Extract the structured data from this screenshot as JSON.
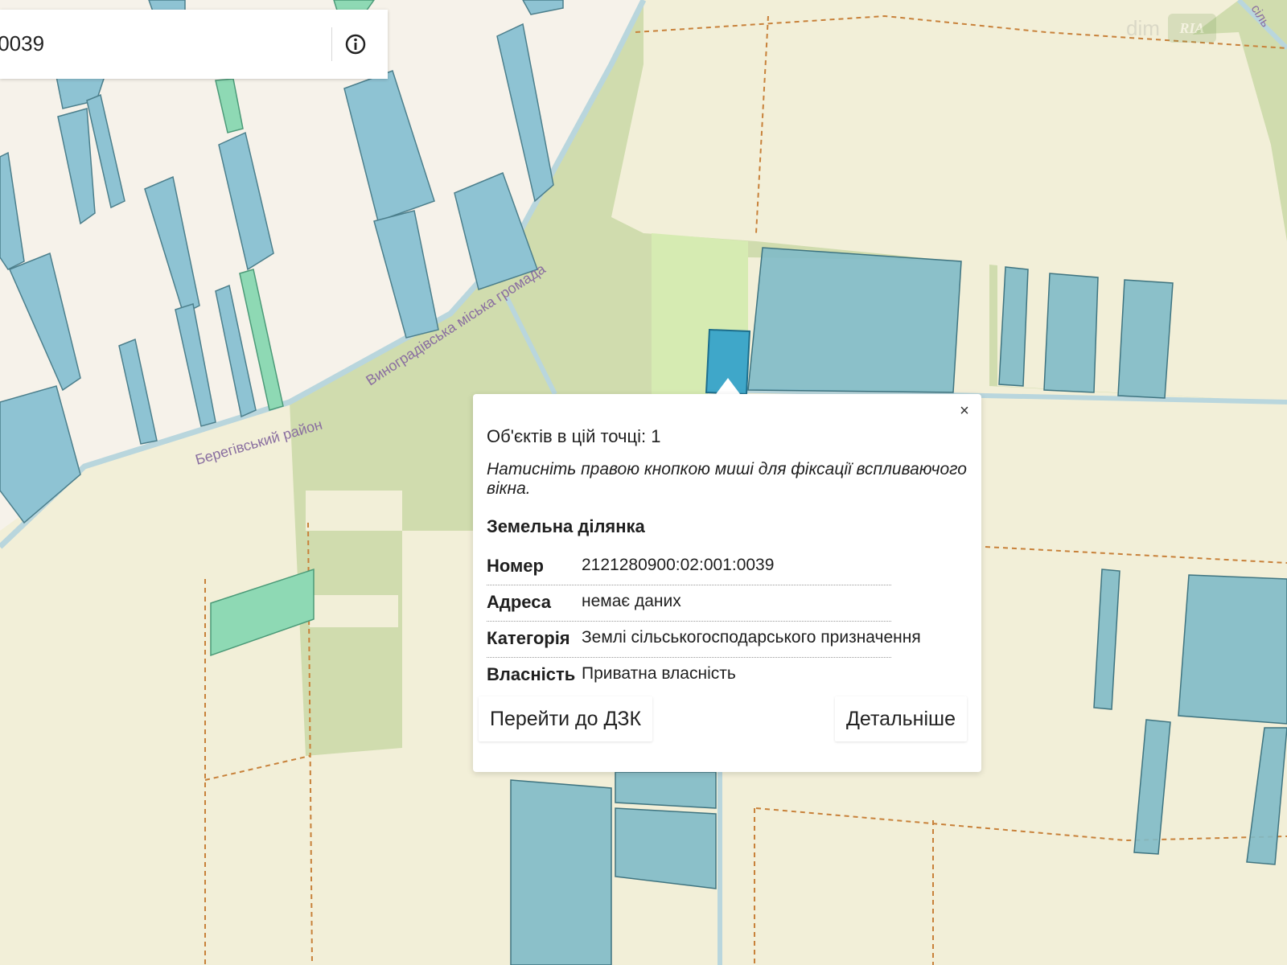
{
  "search": {
    "value": ":0039"
  },
  "map": {
    "labels": {
      "hromada": "Виноградівська міська громада",
      "raion": "Берегівський район",
      "corner": "сіль"
    },
    "colors": {
      "background_fields": "#f2efd8",
      "urban_area": "#f6f2ea",
      "forest": "#cfdcae",
      "meadow": "#d6ebb2",
      "parcel": "#8ec3d3",
      "parcel_border": "#4c7f8c",
      "parcel_green": "#8ed9b4",
      "selected_parcel": "#3fa7c9",
      "admin_border": "#c8813a",
      "road": "#b9d6dd"
    }
  },
  "watermark": {
    "left": "dim",
    "right": "RIA"
  },
  "popup": {
    "close": "×",
    "objects_count": "Об'єктів в цій точці: 1",
    "hint": "Натисніть правою кнопкою миші для фіксації вспливаючого вікна.",
    "section_title": "Земельна ділянка",
    "rows": [
      {
        "key": "Номер",
        "value": "2121280900:02:001:0039"
      },
      {
        "key": "Адреса",
        "value": "немає даних"
      },
      {
        "key": "Категорія",
        "value": "Землі сільськогосподарського призначення"
      },
      {
        "key": "Власність",
        "value": "Приватна власність"
      }
    ],
    "btn_dzk": "Перейти до ДЗК",
    "btn_details": "Детальніше"
  }
}
